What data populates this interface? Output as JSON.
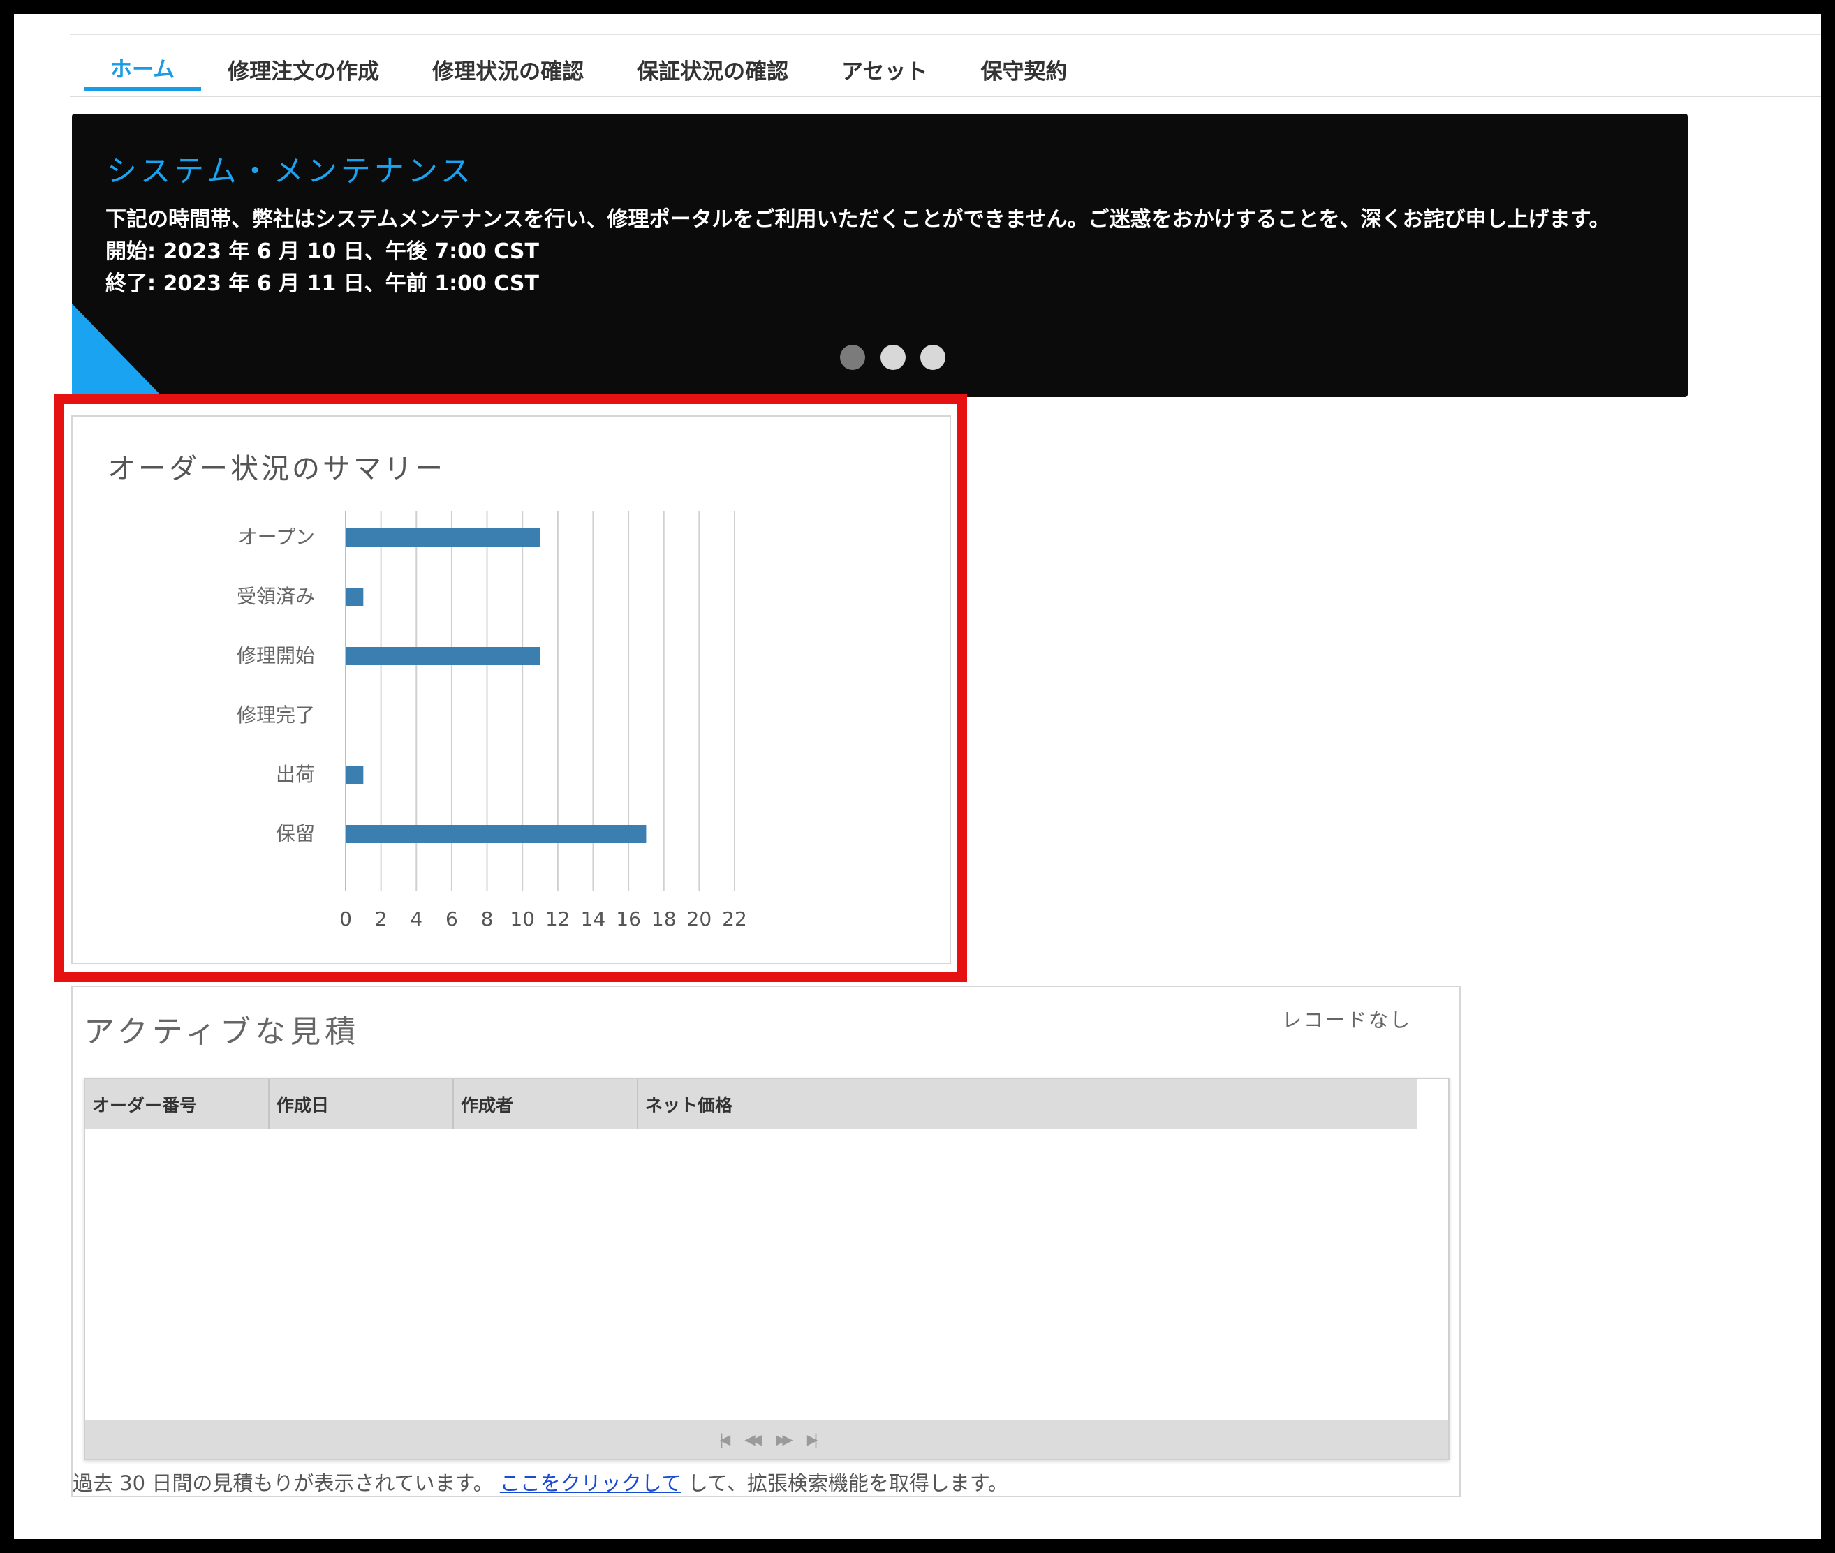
{
  "nav": {
    "tabs": [
      {
        "label": "ホーム",
        "active": true
      },
      {
        "label": "修理注文の作成"
      },
      {
        "label": "修理状況の確認"
      },
      {
        "label": "保証状況の確認"
      },
      {
        "label": "アセット"
      },
      {
        "label": "保守契約"
      }
    ],
    "active_color": "#1a9be6"
  },
  "banner": {
    "title": "システム・メンテナンス",
    "message": "下記の時間帯、弊社はシステムメンテナンスを行い、修理ポータルをご利用いただくことができません。ご迷惑をおかけすることを、深くお詫び申し上げます。",
    "start": "開始: 2023 年 6 月 10 日、午後 7:00 CST",
    "end": "終了: 2023 年 6 月 11 日、午前 1:00 CST",
    "carousel_dots": 3,
    "active_dot": 0,
    "accent_color": "#1aa3f0"
  },
  "summary": {
    "title": "オーダー状況のサマリー"
  },
  "chart_data": {
    "type": "bar",
    "orientation": "horizontal",
    "categories": [
      "オープン",
      "受領済み",
      "修理開始",
      "修理完了",
      "出荷",
      "保留"
    ],
    "values": [
      11,
      1,
      11,
      0,
      1,
      17
    ],
    "xlim": [
      0,
      22
    ],
    "xticks": [
      "0",
      "2",
      "4",
      "6",
      "8",
      "10",
      "12",
      "14",
      "16",
      "18",
      "20",
      "22"
    ],
    "grid": true,
    "bar_color": "#3a7fb0"
  },
  "quotes": {
    "title": "アクティブな見積",
    "no_records": "レコードなし",
    "columns": [
      "オーダー番号",
      "作成日",
      "作成者",
      "ネット価格"
    ],
    "rows": [],
    "pager_icons": [
      "first-page-icon",
      "prev-page-icon",
      "next-page-icon",
      "last-page-icon"
    ],
    "footnote_before": "過去 30 日間の見積もりが表示されています。",
    "footnote_link": "ここをクリックして",
    "footnote_after": "して、拡張検索機能を取得します。"
  }
}
